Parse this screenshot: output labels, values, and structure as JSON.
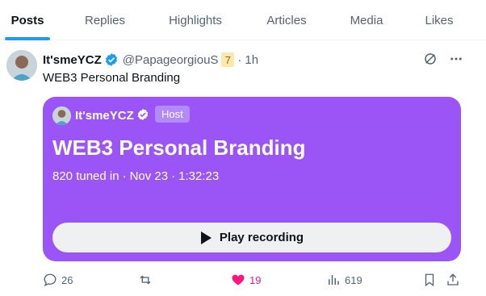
{
  "tabs": [
    {
      "label": "Posts",
      "active": true
    },
    {
      "label": "Replies"
    },
    {
      "label": "Highlights"
    },
    {
      "label": "Articles"
    },
    {
      "label": "Media"
    },
    {
      "label": "Likes"
    }
  ],
  "tweet": {
    "display_name": "It'smeYCZ",
    "handle": "@PapageorgiouS",
    "emoji_badge": "7",
    "separator": "·",
    "time": "1h",
    "text": "WEB3 Personal Branding",
    "icons": [
      "grok-icon",
      "more-icon"
    ]
  },
  "space": {
    "host_name": "It'smeYCZ",
    "host_badge": "Host",
    "title": "WEB3 Personal Branding",
    "tuned_in": "820 tuned in",
    "date": "Nov 23",
    "duration": "1:32:23",
    "separator": "·",
    "play_label": "Play recording",
    "color": "#9b55f7"
  },
  "actions": {
    "replies": "26",
    "reposts": "",
    "likes": "19",
    "views": "619",
    "like_color": "#f91880"
  }
}
